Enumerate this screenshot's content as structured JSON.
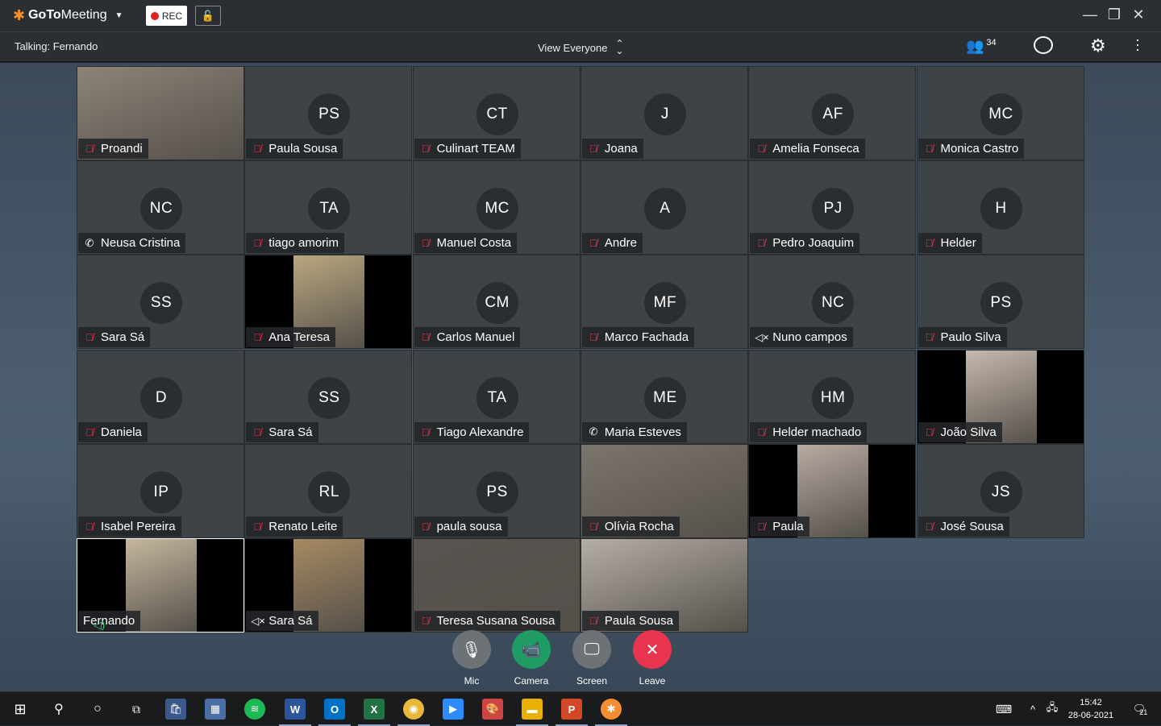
{
  "app": {
    "brand_bold": "GoTo",
    "brand_rest": "Meeting",
    "rec_label": "REC",
    "talking": "Talking: Fernando",
    "view_label": "View Everyone",
    "participant_count": "34"
  },
  "controls": [
    {
      "label": "Mic",
      "color": "#6d7277",
      "icon": "mic-muted-icon",
      "glyph": "🎙"
    },
    {
      "label": "Camera",
      "color": "#1f9c63",
      "icon": "camera-icon",
      "glyph": "📹"
    },
    {
      "label": "Screen",
      "color": "#6d7277",
      "icon": "screen-share-icon",
      "glyph": "🖵"
    },
    {
      "label": "Leave",
      "color": "#e8344e",
      "icon": "leave-icon",
      "glyph": "✕"
    }
  ],
  "tiles": [
    {
      "name": "Proandi",
      "initials": "",
      "status": "muted",
      "video": true,
      "bg": "#8d8378"
    },
    {
      "name": "Paula Sousa",
      "initials": "PS",
      "status": "muted"
    },
    {
      "name": "Culinart TEAM",
      "initials": "CT",
      "status": "muted"
    },
    {
      "name": "Joana",
      "initials": "J",
      "status": "muted"
    },
    {
      "name": "Amelia Fonseca",
      "initials": "AF",
      "status": "muted"
    },
    {
      "name": "Monica Castro",
      "initials": "MC",
      "status": "muted"
    },
    {
      "name": "Neusa Cristina",
      "initials": "NC",
      "status": "phone"
    },
    {
      "name": "tiago amorim",
      "initials": "TA",
      "status": "muted"
    },
    {
      "name": "Manuel Costa",
      "initials": "MC",
      "status": "muted"
    },
    {
      "name": "Andre",
      "initials": "A",
      "status": "muted"
    },
    {
      "name": "Pedro Joaquim",
      "initials": "PJ",
      "status": "muted"
    },
    {
      "name": "Helder",
      "initials": "H",
      "status": "muted"
    },
    {
      "name": "Sara Sá",
      "initials": "SS",
      "status": "muted"
    },
    {
      "name": "Ana Teresa",
      "initials": "",
      "status": "muted",
      "video": true,
      "bg": "#b9a780"
    },
    {
      "name": "Carlos Manuel",
      "initials": "CM",
      "status": "muted"
    },
    {
      "name": "Marco Fachada",
      "initials": "MF",
      "status": "muted"
    },
    {
      "name": "Nuno campos",
      "initials": "NC",
      "status": "speaker-off"
    },
    {
      "name": "Paulo Silva",
      "initials": "PS",
      "status": "muted"
    },
    {
      "name": "Daniela",
      "initials": "D",
      "status": "muted"
    },
    {
      "name": "Sara Sá",
      "initials": "SS",
      "status": "muted"
    },
    {
      "name": "Tiago Alexandre",
      "initials": "TA",
      "status": "muted"
    },
    {
      "name": "Maria Esteves",
      "initials": "ME",
      "status": "phone"
    },
    {
      "name": "Helder machado",
      "initials": "HM",
      "status": "muted"
    },
    {
      "name": "João Silva",
      "initials": "",
      "status": "muted",
      "video": true,
      "bg": "#c7b9ad"
    },
    {
      "name": "Isabel Pereira",
      "initials": "IP",
      "status": "muted"
    },
    {
      "name": "Renato Leite",
      "initials": "RL",
      "status": "muted"
    },
    {
      "name": "paula sousa",
      "initials": "PS",
      "status": "muted"
    },
    {
      "name": "Olívia Rocha",
      "initials": "",
      "status": "muted",
      "video": true,
      "bg": "#7c756c"
    },
    {
      "name": "Paula",
      "initials": "",
      "status": "muted",
      "video": true,
      "bg": "#b8aba3"
    },
    {
      "name": "José Sousa",
      "initials": "JS",
      "status": "muted"
    },
    {
      "name": "Fernando",
      "initials": "",
      "status": "talking",
      "video": true,
      "bg": "#c5b79e",
      "active": true
    },
    {
      "name": "Sara Sá",
      "initials": "",
      "status": "speaker-off",
      "video": true,
      "bg": "#a68a62"
    },
    {
      "name": "Teresa Susana Sousa",
      "initials": "",
      "status": "muted",
      "video": true,
      "bg": "#5a5450"
    },
    {
      "name": "Paula Sousa",
      "initials": "",
      "status": "muted",
      "video": true,
      "bg": "#b5aea7"
    }
  ],
  "taskbar": {
    "time": "15:42",
    "date": "28-06-2021",
    "notifications": "21"
  }
}
